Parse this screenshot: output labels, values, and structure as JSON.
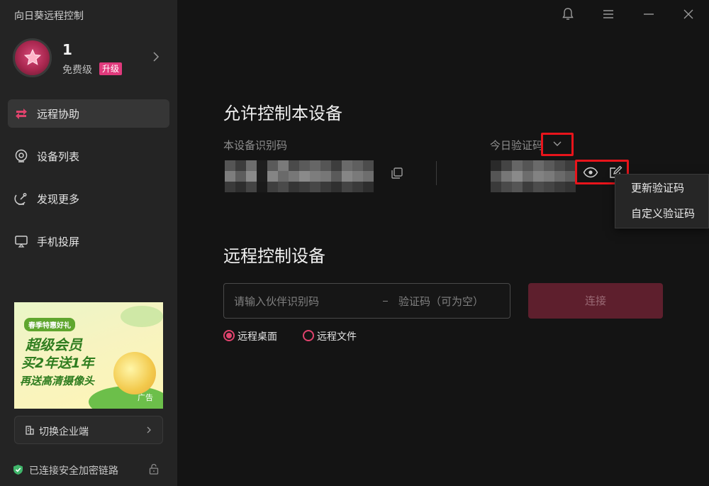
{
  "app": {
    "title": "向日葵远程控制"
  },
  "user": {
    "name": "1",
    "tier": "免费级",
    "upgrade_label": "升级"
  },
  "nav": [
    {
      "label": "远程协助",
      "icon": "remote-assist-icon",
      "active": true
    },
    {
      "label": "设备列表",
      "icon": "device-list-icon",
      "active": false
    },
    {
      "label": "发现更多",
      "icon": "discover-icon",
      "active": false
    },
    {
      "label": "手机投屏",
      "icon": "screen-cast-icon",
      "active": false
    }
  ],
  "ad": {
    "tag": "春季特惠好礼",
    "line1": "超级会员",
    "line2": "买2年送1年",
    "line3": "再送高清摄像头",
    "badge": "广告"
  },
  "switch_enterprise": {
    "label": "切换企业端"
  },
  "status": {
    "secure_label": "已连接安全加密链路"
  },
  "allow_control": {
    "title": "允许控制本设备",
    "device_id_label": "本设备识别码",
    "verify_code_label": "今日验证码"
  },
  "code_menu": {
    "items": [
      "更新验证码",
      "自定义验证码"
    ]
  },
  "remote_control": {
    "title": "远程控制设备",
    "partner_placeholder": "请输入伙伴识别码",
    "code_placeholder": "验证码（可为空）",
    "connect_label": "连接",
    "modes": [
      {
        "label": "远程桌面",
        "selected": true
      },
      {
        "label": "远程文件",
        "selected": false
      }
    ]
  },
  "colors": {
    "accent": "#e0436d",
    "highlight_box": "#e8141b",
    "connect_disabled": "#5e1f2d"
  }
}
